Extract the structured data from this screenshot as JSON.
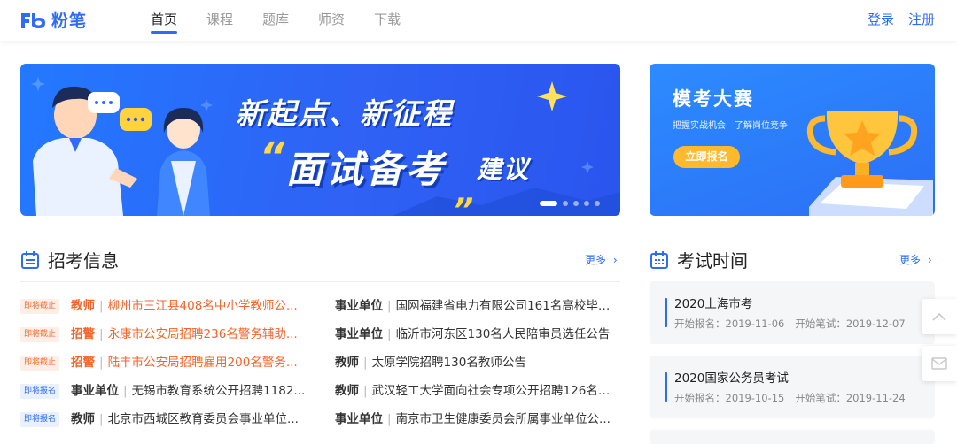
{
  "header": {
    "brand": "粉笔",
    "nav": [
      {
        "label": "首页",
        "active": true
      },
      {
        "label": "课程",
        "active": false
      },
      {
        "label": "题库",
        "active": false
      },
      {
        "label": "师资",
        "active": false
      },
      {
        "label": "下载",
        "active": false
      }
    ],
    "login": "登录",
    "register": "注册"
  },
  "banner": {
    "line1": "新起点、新征程",
    "line2": "面试备考",
    "line2b": "建议",
    "quote_open": "“",
    "quote_close": "„",
    "slide_count": 5,
    "active_slide": 1
  },
  "side_banner": {
    "title": "模考大赛",
    "subtitle": "把握实战机会　了解岗位竞争",
    "button": "立即报名"
  },
  "recruit": {
    "title": "招考信息",
    "more": "更多",
    "rows": [
      {
        "badge": "即将截止",
        "badge_type": "red",
        "left_cat": "教师",
        "left_title": "柳州市三江县408名中小学教师公...",
        "left_hot": true,
        "right_cat": "事业单位",
        "right_title": "国网福建省电力有限公司161名高校毕业..."
      },
      {
        "badge": "即将截止",
        "badge_type": "red",
        "left_cat": "招警",
        "left_title": "永康市公安局招聘236名警务辅助...",
        "left_hot": true,
        "right_cat": "事业单位",
        "right_title": "临沂市河东区130名人民陪审员选任公告"
      },
      {
        "badge": "即将截止",
        "badge_type": "red",
        "left_cat": "招警",
        "left_title": "陆丰市公安局招聘雇用200名警务...",
        "left_hot": true,
        "right_cat": "教师",
        "right_title": "太原学院招聘130名教师公告"
      },
      {
        "badge": "即将报名",
        "badge_type": "blue",
        "left_cat": "事业单位",
        "left_title": "无锡市教育系统公开招聘1182...",
        "left_hot": false,
        "right_cat": "教师",
        "right_title": "武汉轻工大学面向社会专项公开招聘126名专..."
      },
      {
        "badge": "即将报名",
        "badge_type": "blue",
        "left_cat": "教师",
        "left_title": "北京市西城区教育委员会事业单位...",
        "left_hot": false,
        "right_cat": "事业单位",
        "right_title": "南京市卫生健康委员会所属事业单位公..."
      }
    ]
  },
  "exams": {
    "title": "考试时间",
    "more": "更多",
    "items": [
      {
        "name": "2020上海市考",
        "signup": "开始报名：2019-11-06",
        "written": "开始笔试：2019-12-07"
      },
      {
        "name": "2020国家公务员考试",
        "signup": "开始报名：2019-10-15",
        "written": "开始笔试：2019-11-24"
      }
    ]
  },
  "colors": {
    "accent": "#2f6bf6",
    "hot": "#f5632a",
    "gold": "#ffb92d"
  },
  "icons": {
    "scroll_top": "chevron-up-icon",
    "feedback": "mail-icon"
  }
}
